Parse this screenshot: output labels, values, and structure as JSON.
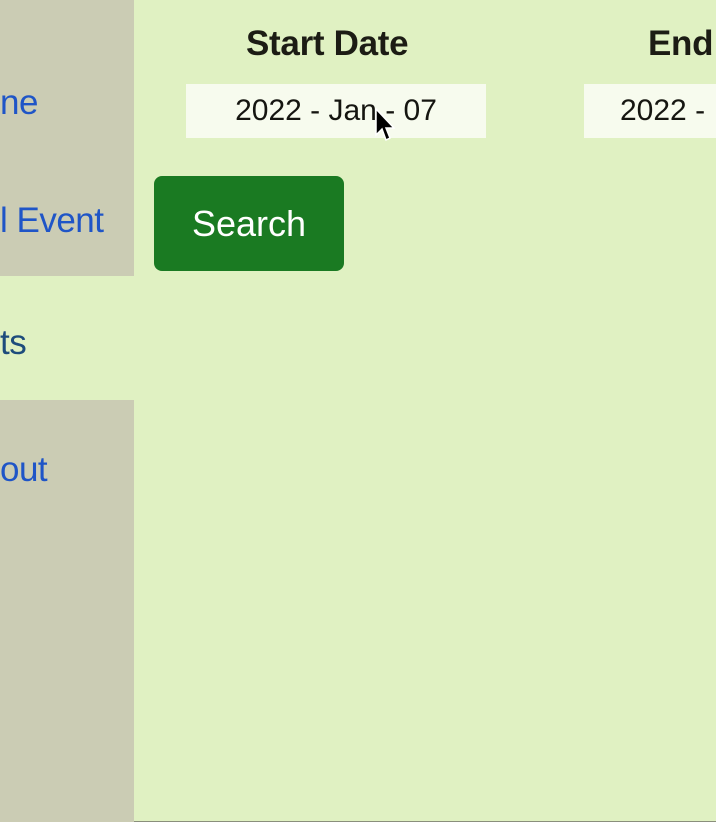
{
  "sidebar": {
    "items": [
      {
        "label": "ne"
      },
      {
        "label": "l Event"
      },
      {
        "label": "ts"
      },
      {
        "label": "out"
      }
    ]
  },
  "filters": {
    "start_label": "Start Date",
    "start_value": "2022 - Jan - 07",
    "end_label": "End",
    "end_value": "2022 -"
  },
  "search_button": "Search",
  "colors": {
    "background": "#e0f1c2",
    "button": "#1a7a22",
    "link": "#1f55c7"
  }
}
